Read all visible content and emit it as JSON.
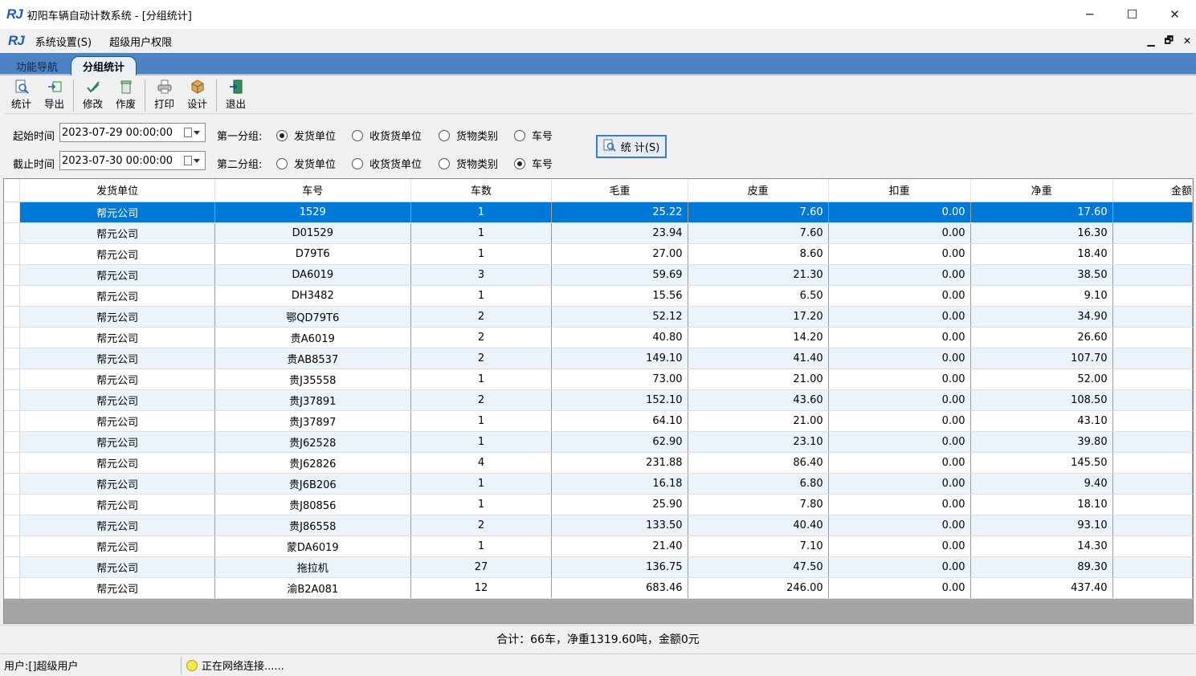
{
  "window": {
    "logo": "RJ",
    "title": "初阳车辆自动计数系统 - [分组统计]",
    "min": "─",
    "max": "☐",
    "close": "✕"
  },
  "menu": {
    "items": [
      "系统设置(S)",
      "超级用户权限"
    ],
    "mdi_min": "▁",
    "mdi_restore": "🗗",
    "mdi_close": "✕"
  },
  "tabs": [
    {
      "label": "功能导航"
    },
    {
      "label": "分组统计"
    }
  ],
  "toolbar": {
    "buttons": [
      {
        "label": "统计",
        "icon": "stats-icon"
      },
      {
        "label": "导出",
        "icon": "export-icon"
      },
      {
        "label": "修改",
        "icon": "edit-icon"
      },
      {
        "label": "作废",
        "icon": "trash-icon"
      },
      {
        "label": "打印",
        "icon": "print-icon"
      },
      {
        "label": "设计",
        "icon": "design-icon"
      },
      {
        "label": "退出",
        "icon": "exit-icon"
      }
    ]
  },
  "filters": {
    "start_label": "起始时间",
    "start_value": "2023-07-29 00:00:00",
    "end_label": "截止时间",
    "end_value": "2023-07-30 00:00:00",
    "group1_label": "第一分组:",
    "group2_label": "第二分组:",
    "options": [
      "发货单位",
      "收货货单位",
      "货物类别",
      "车号"
    ],
    "group1_selected": "发货单位",
    "group2_selected": "车号",
    "stat_button": "统 计(S)"
  },
  "table": {
    "columns": [
      "发货单位",
      "车号",
      "车数",
      "毛重",
      "皮重",
      "扣重",
      "净重",
      "金额"
    ],
    "rows": [
      [
        "帮元公司",
        "1529",
        "1",
        "25.22",
        "7.60",
        "0.00",
        "17.60",
        ""
      ],
      [
        "帮元公司",
        "D01529",
        "1",
        "23.94",
        "7.60",
        "0.00",
        "16.30",
        ""
      ],
      [
        "帮元公司",
        "D79T6",
        "1",
        "27.00",
        "8.60",
        "0.00",
        "18.40",
        ""
      ],
      [
        "帮元公司",
        "DA6019",
        "3",
        "59.69",
        "21.30",
        "0.00",
        "38.50",
        ""
      ],
      [
        "帮元公司",
        "DH3482",
        "1",
        "15.56",
        "6.50",
        "0.00",
        "9.10",
        ""
      ],
      [
        "帮元公司",
        "鄂QD79T6",
        "2",
        "52.12",
        "17.20",
        "0.00",
        "34.90",
        ""
      ],
      [
        "帮元公司",
        "贵A6019",
        "2",
        "40.80",
        "14.20",
        "0.00",
        "26.60",
        ""
      ],
      [
        "帮元公司",
        "贵AB8537",
        "2",
        "149.10",
        "41.40",
        "0.00",
        "107.70",
        ""
      ],
      [
        "帮元公司",
        "贵J35558",
        "1",
        "73.00",
        "21.00",
        "0.00",
        "52.00",
        ""
      ],
      [
        "帮元公司",
        "贵J37891",
        "2",
        "152.10",
        "43.60",
        "0.00",
        "108.50",
        ""
      ],
      [
        "帮元公司",
        "贵J37897",
        "1",
        "64.10",
        "21.00",
        "0.00",
        "43.10",
        ""
      ],
      [
        "帮元公司",
        "贵J62528",
        "1",
        "62.90",
        "23.10",
        "0.00",
        "39.80",
        ""
      ],
      [
        "帮元公司",
        "贵J62826",
        "4",
        "231.88",
        "86.40",
        "0.00",
        "145.50",
        ""
      ],
      [
        "帮元公司",
        "贵J6B206",
        "1",
        "16.18",
        "6.80",
        "0.00",
        "9.40",
        ""
      ],
      [
        "帮元公司",
        "贵J80856",
        "1",
        "25.90",
        "7.80",
        "0.00",
        "18.10",
        ""
      ],
      [
        "帮元公司",
        "贵J86558",
        "2",
        "133.50",
        "40.40",
        "0.00",
        "93.10",
        ""
      ],
      [
        "帮元公司",
        "蒙DA6019",
        "1",
        "21.40",
        "7.10",
        "0.00",
        "14.30",
        ""
      ],
      [
        "帮元公司",
        "拖拉机",
        "27",
        "136.75",
        "47.50",
        "0.00",
        "89.30",
        ""
      ],
      [
        "帮元公司",
        "渝B2A081",
        "12",
        "683.46",
        "246.00",
        "0.00",
        "437.40",
        ""
      ]
    ]
  },
  "summary": "合计：66车，净重1319.60吨，金额0元",
  "status": {
    "user": "用户:[]超级用户",
    "network": "正在网络连接......"
  }
}
